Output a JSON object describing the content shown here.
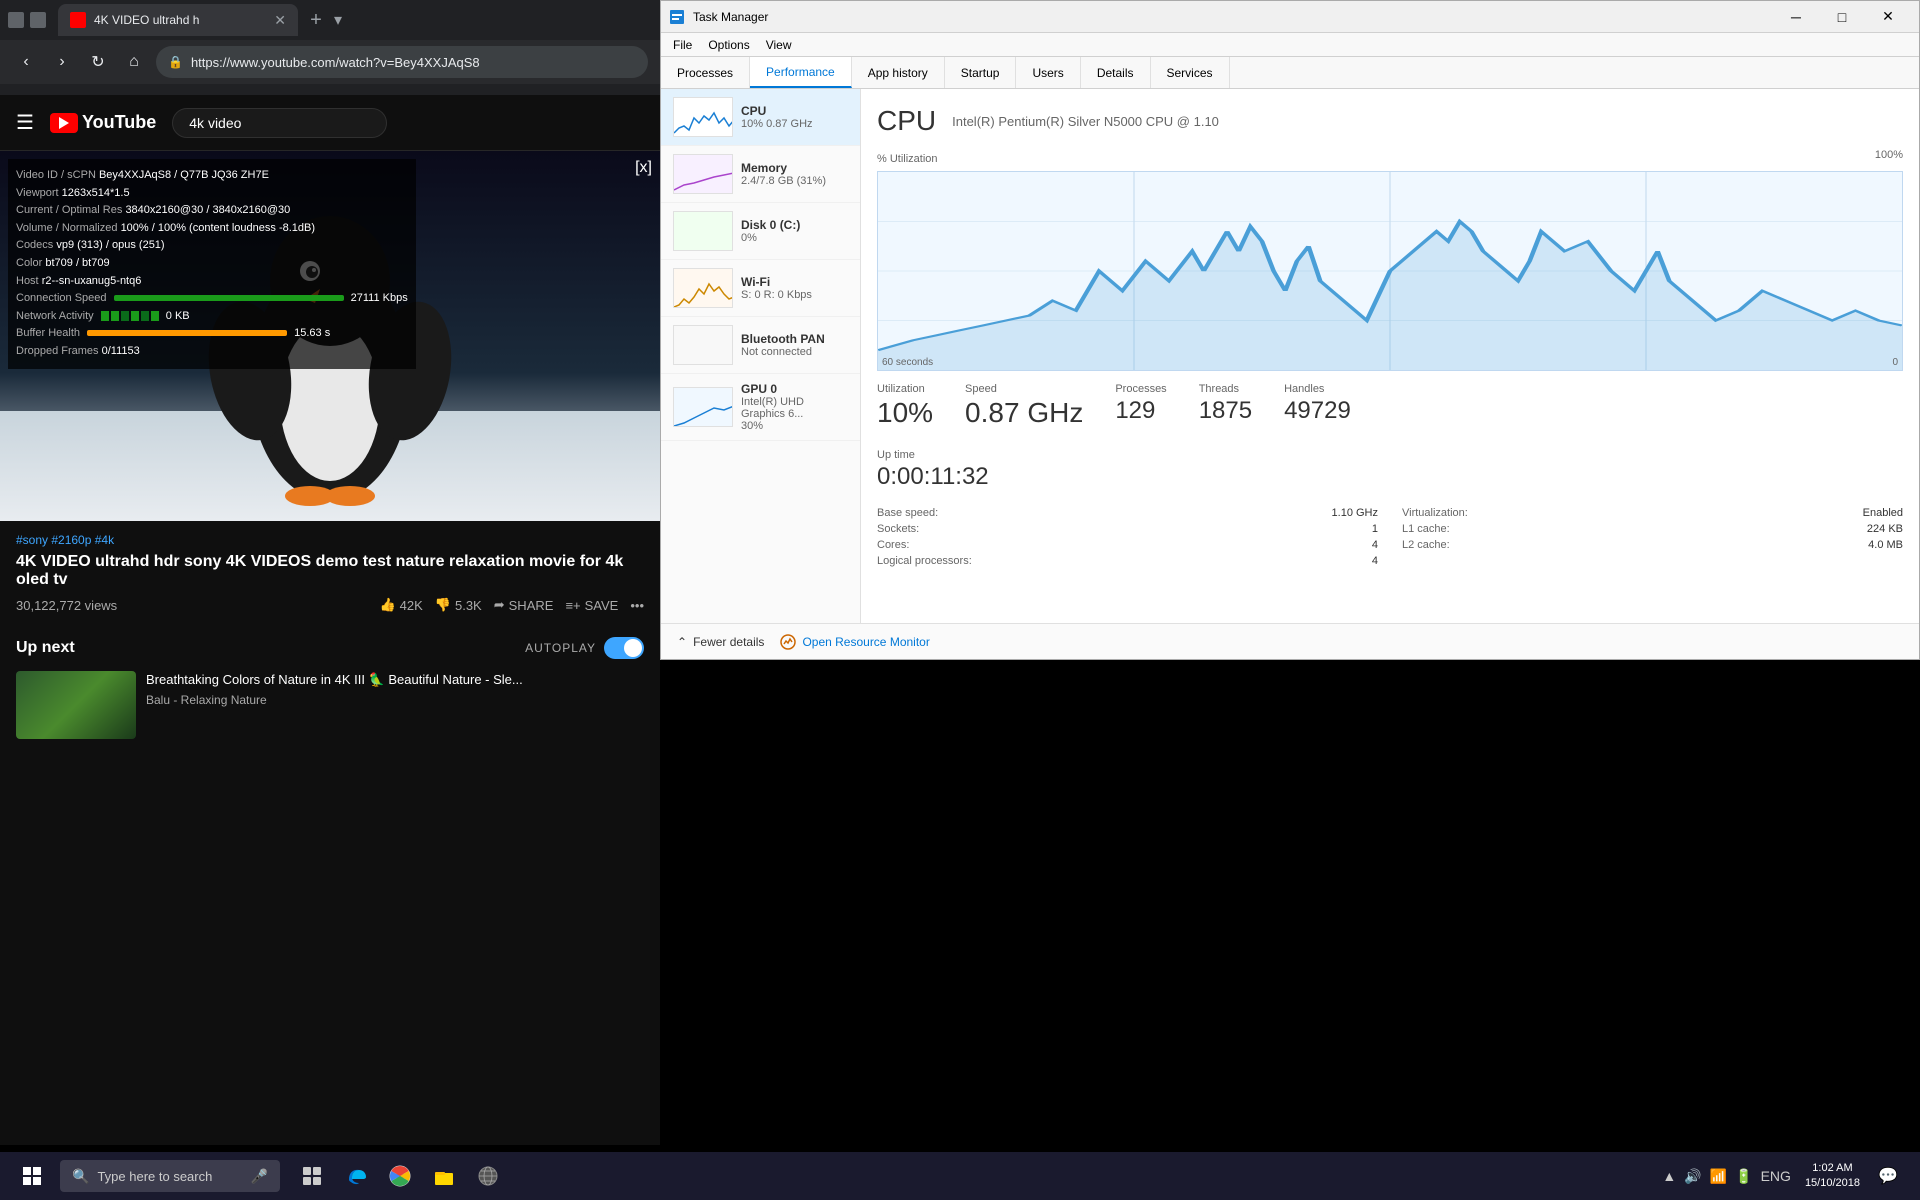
{
  "browser": {
    "tab_title": "4K VIDEO ultrahd h",
    "url": "https://www.youtube.com/watch?v=Bey4XXJAqS8",
    "favicon_color": "#ff0000"
  },
  "youtube": {
    "logo_text": "YouTube",
    "search_placeholder": "4k video",
    "video_debug": {
      "video_id": "Video ID / sCPN",
      "video_id_val": "Bey4XXJAqS8 / Q77B JQ36 ZH7E",
      "viewport": "Viewport",
      "viewport_val": "1263x514*1.5",
      "current_res": "Current / Optimal Res",
      "current_res_val": "3840x2160@30 / 3840x2160@30",
      "volume": "Volume / Normalized",
      "volume_val": "100% / 100% (content loudness -8.1dB)",
      "codecs": "Codecs",
      "codecs_val": "vp9 (313) / opus (251)",
      "color": "Color",
      "color_val": "bt709 / bt709",
      "host": "Host",
      "host_val": "r2--sn-uxanug5-ntq6",
      "conn_speed": "Connection Speed",
      "conn_speed_val": "27111 Kbps",
      "net_activity": "Network Activity",
      "net_activity_val": "0 KB",
      "buffer_health": "Buffer Health",
      "buffer_health_val": "15.63 s",
      "dropped_frames": "Dropped Frames",
      "dropped_frames_val": "0/11153"
    },
    "tags": "#sony #2160p #4k",
    "title": "4K VIDEO ultrahd hdr sony 4K VIDEOS demo test nature relaxation movie for 4k oled tv",
    "views": "30,122,772 views",
    "likes": "42K",
    "dislikes": "5.3K",
    "share": "SHARE",
    "save": "SAVE",
    "up_next": "Up next",
    "autoplay": "AUTOPLAY",
    "next_title": "Breathtaking Colors of Nature in 4K III 🦜 Beautiful Nature - Sle...",
    "next_channel": "Balu - Relaxing Nature"
  },
  "task_manager": {
    "title": "Task Manager",
    "menus": [
      "File",
      "Options",
      "View"
    ],
    "tabs": [
      "Processes",
      "Performance",
      "App history",
      "Startup",
      "Users",
      "Details",
      "Services"
    ],
    "active_tab": "Performance",
    "sidebar_items": [
      {
        "name": "CPU",
        "value": "10%  0.87 GHz",
        "active": true
      },
      {
        "name": "Memory",
        "value": "2.4/7.8 GB (31%)",
        "active": false
      },
      {
        "name": "Disk 0 (C:)",
        "value": "0%",
        "active": false
      },
      {
        "name": "Wi-Fi",
        "value": "S: 0  R: 0 Kbps",
        "active": false
      },
      {
        "name": "Bluetooth PAN",
        "value": "Not connected",
        "active": false
      },
      {
        "name": "GPU 0",
        "value": "Intel(R) UHD Graphics 6...",
        "value2": "30%",
        "active": false
      }
    ],
    "cpu": {
      "title": "CPU",
      "full_name": "Intel(R) Pentium(R) Silver N5000 CPU @ 1.10",
      "utilization_label": "% Utilization",
      "max_label": "100%",
      "time_label": "60 seconds",
      "zero_label": "0",
      "utilization_pct": "10%",
      "speed": "0.87 GHz",
      "processes": "129",
      "threads": "1875",
      "handles": "49729",
      "uptime": "0:00:11:32",
      "base_speed_label": "Base speed:",
      "base_speed_val": "1.10 GHz",
      "sockets_label": "Sockets:",
      "sockets_val": "1",
      "cores_label": "Cores:",
      "cores_val": "4",
      "logical_label": "Logical processors:",
      "logical_val": "4",
      "virt_label": "Virtualization:",
      "virt_val": "Enabled",
      "l1_label": "L1 cache:",
      "l1_val": "224 KB",
      "l2_label": "L2 cache:",
      "l2_val": "4.0 MB",
      "util_label": "Utilization",
      "speed_label": "Speed",
      "proc_label": "Processes",
      "threads_label": "Threads",
      "handles_label": "Handles",
      "uptime_label": "Up time"
    },
    "footer": {
      "fewer_details": "Fewer details",
      "open_monitor": "Open Resource Monitor"
    }
  },
  "taskbar": {
    "search_placeholder": "Type here to search",
    "time": "1:02 AM",
    "date": "15/10/2018",
    "language": "ENG"
  }
}
